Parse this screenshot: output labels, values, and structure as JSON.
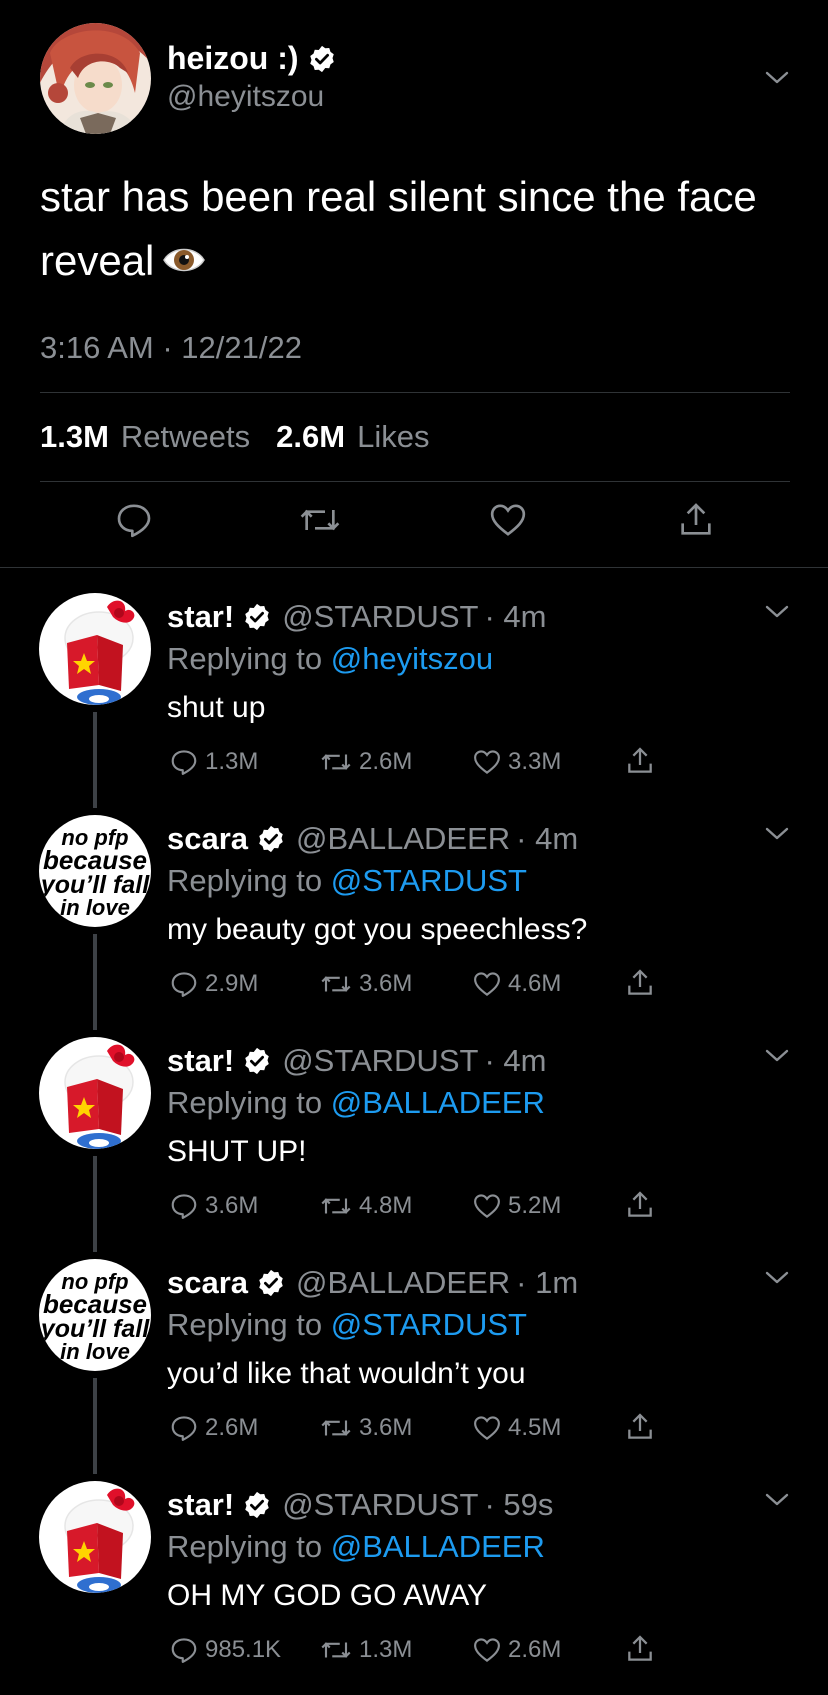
{
  "main_tweet": {
    "display_name": "heizou :)",
    "handle": "@heyitszou",
    "text": "star has been real silent since the face reveal",
    "timestamp": "3:16 AM · 12/21/22",
    "retweets_count": "1.3M",
    "retweets_label": "Retweets",
    "likes_count": "2.6M",
    "likes_label": "Likes"
  },
  "replies": [
    {
      "display_name": "star!",
      "handle": "@STARDUST",
      "age": "· 4m",
      "replying_label": "Replying to",
      "replying_to": "@heyitszou",
      "text": "shut up",
      "replies": "1.3M",
      "retweets": "2.6M",
      "likes": "3.3M"
    },
    {
      "display_name": "scara",
      "handle": "@BALLADEER",
      "age": "· 4m",
      "replying_label": "Replying to",
      "replying_to": "@STARDUST",
      "text": "my beauty got you speechless?",
      "replies": "2.9M",
      "retweets": "3.6M",
      "likes": "4.6M"
    },
    {
      "display_name": "star!",
      "handle": "@STARDUST",
      "age": "· 4m",
      "replying_label": "Replying to",
      "replying_to": "@BALLADEER",
      "text": "SHUT UP!",
      "replies": "3.6M",
      "retweets": "4.8M",
      "likes": "5.2M"
    },
    {
      "display_name": "scara",
      "handle": "@BALLADEER",
      "age": "· 1m",
      "replying_label": "Replying to",
      "replying_to": "@STARDUST",
      "text": "you’d like that wouldn’t you",
      "replies": "2.6M",
      "retweets": "3.6M",
      "likes": "4.5M"
    },
    {
      "display_name": "star!",
      "handle": "@STARDUST",
      "age": "· 59s",
      "replying_label": "Replying to",
      "replying_to": "@BALLADEER",
      "text": "OH MY GOD GO AWAY",
      "replies": "985.1K",
      "retweets": "1.3M",
      "likes": "2.6M"
    }
  ],
  "scara_avatar_text": [
    "no pfp",
    "because",
    "you’ll fall",
    "in love"
  ],
  "colors": {
    "link": "#1d9bf0",
    "muted": "#8b8f94",
    "background": "#000000"
  }
}
